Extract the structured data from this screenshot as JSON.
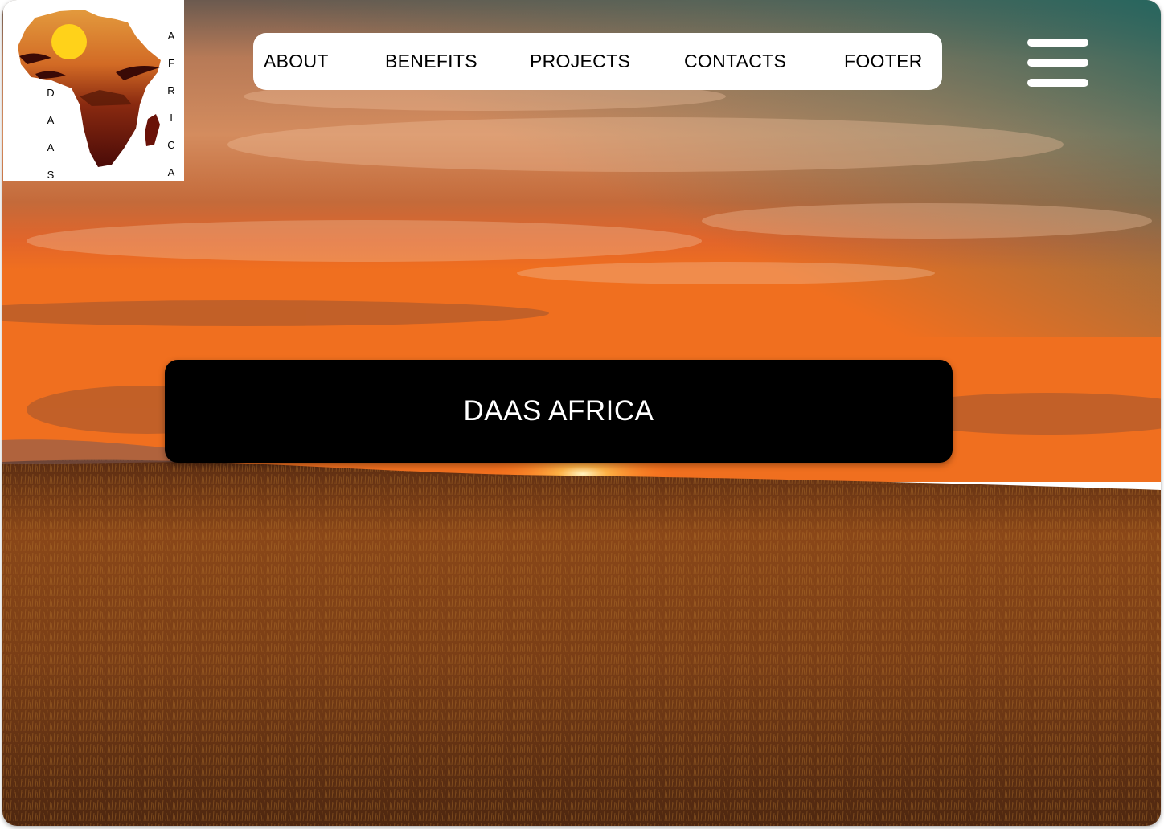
{
  "logo": {
    "letters_left": [
      "D",
      "A",
      "A",
      "S"
    ],
    "letters_right": [
      "A",
      "F",
      "R",
      "I",
      "C",
      "A"
    ]
  },
  "nav": {
    "items": [
      {
        "label": "ABOUT"
      },
      {
        "label": "BENEFITS"
      },
      {
        "label": "PROJECTS"
      },
      {
        "label": "CONTACTS"
      },
      {
        "label": "FOOTER"
      }
    ]
  },
  "menu": {
    "icon": "hamburger-menu-icon"
  },
  "hero": {
    "title": "DAAS AFRICA"
  },
  "colors": {
    "sky_top": "#2f6b63",
    "sky_mid": "#d98a55",
    "horizon": "#ff7a1a",
    "field": "#7a3f14",
    "banner": "#000000",
    "nav_bg": "#ffffff"
  }
}
